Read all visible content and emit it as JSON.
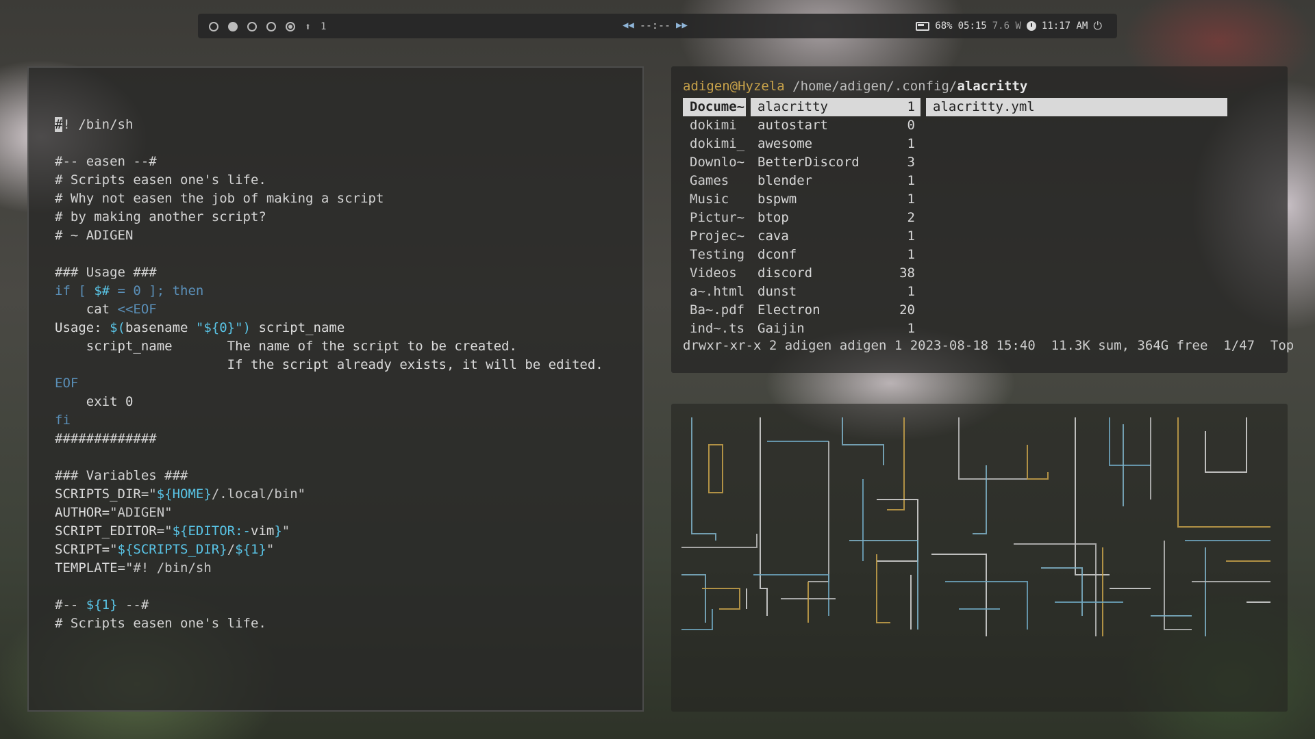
{
  "topbar": {
    "workspace_count": "1",
    "media_time": "--:--",
    "battery": "68%",
    "battery_time": "05:15",
    "power_draw": "7.6 W",
    "clock": "11:17 AM",
    "icons": [
      "battery-icon",
      "clock-icon",
      "power-icon",
      "prev-track-icon",
      "next-track-icon"
    ]
  },
  "editor": {
    "lines": [
      [
        {
          "t": "#",
          "c": "cursor"
        },
        {
          "t": "! /bin/sh",
          "c": "comment"
        }
      ],
      [],
      [
        {
          "t": "#-- easen --#",
          "c": "comment"
        }
      ],
      [
        {
          "t": "# Scripts easen one's life.",
          "c": "comment"
        }
      ],
      [
        {
          "t": "# Why not easen the job of making a script",
          "c": "comment"
        }
      ],
      [
        {
          "t": "# by making another script?",
          "c": "comment"
        }
      ],
      [
        {
          "t": "# ~ ADIGEN",
          "c": "comment"
        }
      ],
      [],
      [
        {
          "t": "### Usage ###",
          "c": "comment"
        }
      ],
      [
        {
          "t": "if [ ",
          "c": "kw"
        },
        {
          "t": "$#",
          "c": "var"
        },
        {
          "t": " = 0 ]; then",
          "c": "kw"
        }
      ],
      [
        {
          "t": "    cat ",
          "c": "plain"
        },
        {
          "t": "<<EOF",
          "c": "kw"
        }
      ],
      [
        {
          "t": "Usage: ",
          "c": "plain"
        },
        {
          "t": "$(",
          "c": "var"
        },
        {
          "t": "basename ",
          "c": "plain"
        },
        {
          "t": "\"${0}\"",
          "c": "var"
        },
        {
          "t": ") ",
          "c": "var"
        },
        {
          "t": "script_name",
          "c": "plain"
        }
      ],
      [
        {
          "t": "    script_name       The name of the script to be created.",
          "c": "plain"
        }
      ],
      [
        {
          "t": "                      If the script already exists, it will be edited.",
          "c": "plain"
        }
      ],
      [
        {
          "t": "EOF",
          "c": "kw"
        }
      ],
      [
        {
          "t": "    exit 0",
          "c": "plain"
        }
      ],
      [
        {
          "t": "fi",
          "c": "kw"
        }
      ],
      [
        {
          "t": "#############",
          "c": "comment"
        }
      ],
      [],
      [
        {
          "t": "### Variables ###",
          "c": "comment"
        }
      ],
      [
        {
          "t": "SCRIPTS_DIR=",
          "c": "plain"
        },
        {
          "t": "\"",
          "c": "str"
        },
        {
          "t": "${HOME}",
          "c": "var"
        },
        {
          "t": "/.local/bin\"",
          "c": "str"
        }
      ],
      [
        {
          "t": "AUTHOR=",
          "c": "plain"
        },
        {
          "t": "\"ADIGEN\"",
          "c": "str"
        }
      ],
      [
        {
          "t": "SCRIPT_EDITOR=",
          "c": "plain"
        },
        {
          "t": "\"",
          "c": "str"
        },
        {
          "t": "${EDITOR:-",
          "c": "var"
        },
        {
          "t": "vim",
          "c": "plain"
        },
        {
          "t": "}",
          "c": "var"
        },
        {
          "t": "\"",
          "c": "str"
        }
      ],
      [
        {
          "t": "SCRIPT=",
          "c": "plain"
        },
        {
          "t": "\"",
          "c": "str"
        },
        {
          "t": "${SCRIPTS_DIR}",
          "c": "var"
        },
        {
          "t": "/",
          "c": "str"
        },
        {
          "t": "${1}",
          "c": "var"
        },
        {
          "t": "\"",
          "c": "str"
        }
      ],
      [
        {
          "t": "TEMPLATE=",
          "c": "plain"
        },
        {
          "t": "\"#! /bin/sh",
          "c": "str"
        }
      ],
      [],
      [
        {
          "t": "#-- ",
          "c": "comment"
        },
        {
          "t": "${1}",
          "c": "var"
        },
        {
          "t": " --#",
          "c": "comment"
        }
      ],
      [
        {
          "t": "# Scripts easen one's life.",
          "c": "comment"
        }
      ]
    ],
    "colors": {
      "comment": "#d4d4d4",
      "kw": "#5a8fb8",
      "var": "#59c4e6",
      "str": "#c9c9c9",
      "plain": "#dcdcdc"
    }
  },
  "filemgr": {
    "user_host": "adigen@Hyzela",
    "path": " /home/adigen/.config/",
    "current": "alacritty",
    "parent": [
      "Docume~",
      "dokimi",
      "dokimi_",
      "Downlo~",
      "Games",
      "Music",
      "Pictur~",
      "Projec~",
      "Testing",
      "Videos",
      "a~.html",
      "Ba~.pdf",
      "ind~.ts"
    ],
    "parent_selected": 0,
    "entries": [
      {
        "name": "alacritty",
        "count": "1"
      },
      {
        "name": "autostart",
        "count": "0"
      },
      {
        "name": "awesome",
        "count": "1"
      },
      {
        "name": "BetterDiscord",
        "count": "3"
      },
      {
        "name": "blender",
        "count": "1"
      },
      {
        "name": "bspwm",
        "count": "1"
      },
      {
        "name": "btop",
        "count": "2"
      },
      {
        "name": "cava",
        "count": "1"
      },
      {
        "name": "dconf",
        "count": "1"
      },
      {
        "name": "discord",
        "count": "38"
      },
      {
        "name": "dunst",
        "count": "1"
      },
      {
        "name": "Electron",
        "count": "20"
      },
      {
        "name": "Gaijin",
        "count": "1"
      }
    ],
    "entries_selected": 0,
    "preview": [
      "alacritty.yml"
    ],
    "status": "drwxr-xr-x 2 adigen adigen 1 2023-08-18 15:40  11.3K sum, 364G free  1/47  Top"
  }
}
